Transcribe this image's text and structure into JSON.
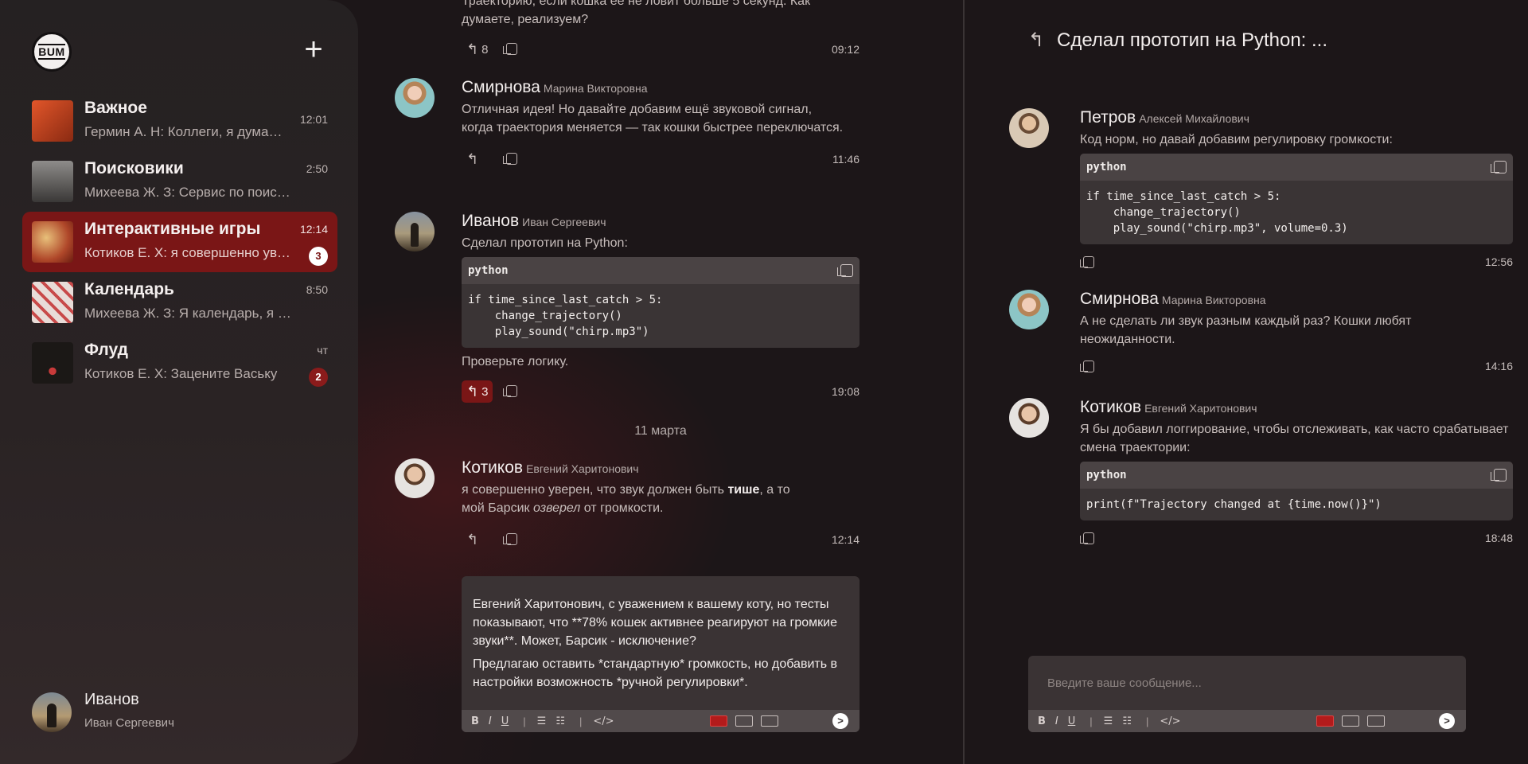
{
  "brand": {
    "logo_text": "BUM"
  },
  "sidebar": {
    "new_chat_glyph": "+",
    "chats": [
      {
        "title": "Важное",
        "preview": "Гермин А. Н:  Коллеги, я думаю, что нам стоит",
        "time": "12:01",
        "badge": "",
        "thumb_color": "#d64a1f"
      },
      {
        "title": "Поисковики",
        "preview": "Михеева Ж. З:  Сервис по поиску информации",
        "time": "2:50",
        "badge": "",
        "thumb_color": "#5e5c5a"
      },
      {
        "title": "Интерактивные игры",
        "preview": "Котиков Е. Х:  я совершенно уверен, что звук",
        "time": "12:14",
        "badge": "3",
        "thumb_color": "#b85a2a"
      },
      {
        "title": "Календарь",
        "preview": "Михеева Ж. З:  Я календарь, я мечтаю",
        "time": "8:50",
        "badge": "",
        "thumb_color": "#d9c9c4"
      },
      {
        "title": "Флуд",
        "preview": "Котиков Е. Х:  Зацените Ваську",
        "time": "чт",
        "badge": "2",
        "thumb_color": "#1d1a18"
      }
    ],
    "user": {
      "name": "Иванов",
      "patronymic": "Иван Сергеевич"
    }
  },
  "main": {
    "messages": [
      {
        "author": "",
        "patronymic": "",
        "text": "Траекторию, если кошка её не ловит больше 5 секунд. Как думаете, реализуем?",
        "reply_count": "8",
        "time": "09:12"
      },
      {
        "author": "Смирнова",
        "patronymic": "Марина Викторовна",
        "text": "Отличная идея! Но давайте добавим ещё звуковой сигнал, когда траектория меняется — так кошки быстрее переключатся.",
        "reply_count": "",
        "time": "11:46"
      },
      {
        "author": "Иванов",
        "patronymic": "Иван Сергеевич",
        "text": "Сделал прототип на Python:",
        "code_lang": "python",
        "code": "if time_since_last_catch > 5:\n    change_trajectory()\n    play_sound(\"chirp.mp3\")",
        "text_after": "Проверьте логику.",
        "reply_count": "3",
        "time": "19:08"
      },
      {
        "author": "Котиков",
        "patronymic": "Евгений Харитонович",
        "text_a": "я совершенно уверен, что звук должен быть ",
        "text_bold": "тише",
        "text_b": ", а то мой Барсик ",
        "text_italic": "озверел",
        "text_c": " от громкости.",
        "reply_count": "",
        "time": "12:14"
      }
    ],
    "date_separator": "11 марта",
    "composer": {
      "paragraph_1": "Евгений Харитонович, с уважением к вашему коту, но тесты показывают, что **78% кошек активнее реагируют на громкие звуки**. Может, Барсик - исключение?",
      "paragraph_2": "Предлагаю оставить *стандартную* громкость, но добавить в настройки возможность *ручной регулировки*.",
      "send_glyph": ">"
    }
  },
  "thread": {
    "title": "Сделал прототип на Python: ...",
    "messages": [
      {
        "author": "Петров",
        "patronymic": "Алексей Михайлович",
        "text": "Код норм, но давай добавим регулировку громкости:",
        "code_lang": "python",
        "code": "if time_since_last_catch > 5:\n    change_trajectory()\n    play_sound(\"chirp.mp3\", volume=0.3)",
        "time": "12:56"
      },
      {
        "author": "Смирнова",
        "patronymic": "Марина Викторовна",
        "text": "А не сделать ли звук разным каждый раз? Кошки любят неожиданности.",
        "time": "14:16"
      },
      {
        "author": "Котиков",
        "patronymic": "Евгений Харитонович",
        "text": "Я бы добавил логгирование, чтобы отслеживать, как часто срабатывает смена траектории:",
        "code_lang": "python",
        "code": "print(f\"Trajectory changed at {time.now()}\")",
        "time": "18:48"
      }
    ],
    "composer": {
      "placeholder": "Введите ваше сообщение...",
      "send_glyph": ">"
    }
  },
  "toolbar": {
    "bold": "B",
    "italic": "I",
    "underline": "U",
    "sep": "|",
    "code": "</>"
  },
  "colors": {
    "accent": "#7a1616",
    "background": "#1c1618",
    "sidebar": "#252122",
    "panel": "#3a3334"
  }
}
